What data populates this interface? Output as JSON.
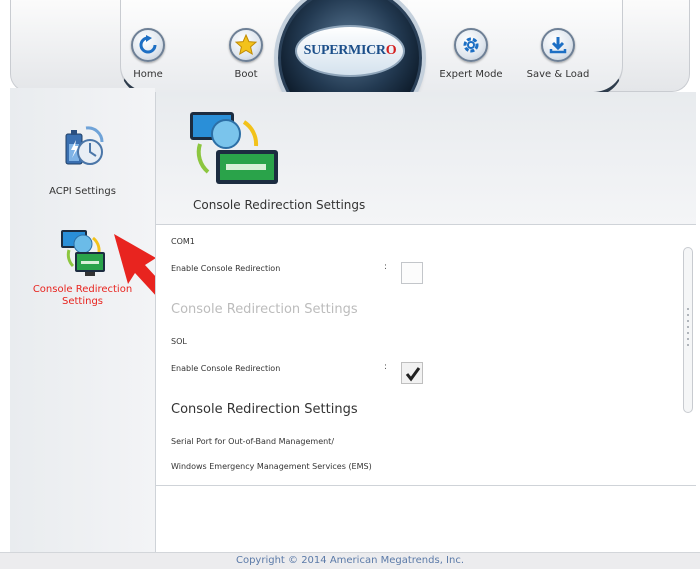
{
  "header": {
    "logo_text_main": "SUPERMICR",
    "logo_text_accent": "O",
    "nav": [
      {
        "label": "Home",
        "icon": "home-refresh-icon"
      },
      {
        "label": "Boot",
        "icon": "star-icon"
      },
      {
        "label": "Expert Mode",
        "icon": "gear-icon"
      },
      {
        "label": "Save & Load",
        "icon": "download-icon"
      }
    ]
  },
  "sidebar": {
    "items": [
      {
        "label": "ACPI Settings",
        "icon": "battery-power-icon",
        "active": false
      },
      {
        "label_line1": "Console Redirection",
        "label_line2": "Settings",
        "icon": "monitors-network-icon",
        "active": true
      }
    ]
  },
  "content": {
    "title": "Console Redirection Settings",
    "com1_label": "COM1",
    "com1_enable_label": "Enable Console Redirection",
    "colon": ":",
    "com1_enabled": false,
    "section_disabled_title": "Console Redirection Settings",
    "sol_label": "SOL",
    "sol_enable_label": "Enable Console Redirection",
    "sol_enabled": true,
    "section_title": "Console Redirection Settings",
    "serial_port_label": "Serial Port for Out-of-Band Management/",
    "ems_label": "Windows Emergency Management Services (EMS)"
  },
  "footer": {
    "copyright": "Copyright © 2014 American Megatrends, Inc."
  },
  "colors": {
    "accent_red": "#e8241f",
    "footer_text": "#5b7aa8",
    "header_dark": "#2e3c4c"
  }
}
